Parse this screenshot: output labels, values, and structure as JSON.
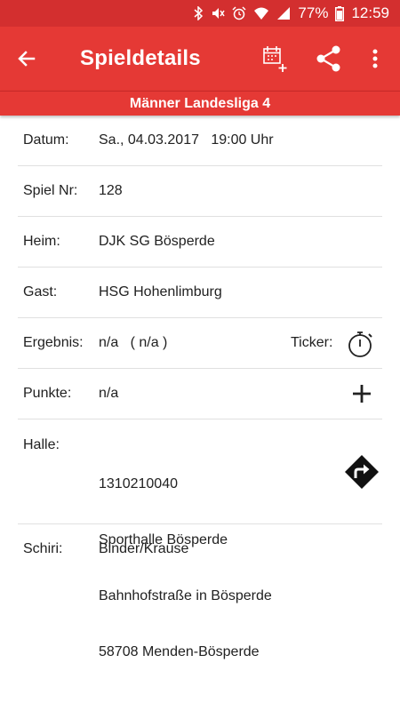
{
  "status_bar": {
    "battery_percent": "77%",
    "time": "12:59",
    "icons": [
      "bluetooth-icon",
      "mute-icon",
      "alarm-icon",
      "wifi-icon",
      "signal-icon",
      "battery-icon"
    ]
  },
  "app_bar": {
    "title": "Spieldetails",
    "actions": [
      "back-arrow-icon",
      "calendar-add-icon",
      "share-icon",
      "more-vert-icon"
    ]
  },
  "league": "Männer Landesliga 4",
  "details": {
    "datum": {
      "label": "Datum:",
      "value": "Sa., 04.03.2017   19:00 Uhr"
    },
    "spiel_nr": {
      "label": "Spiel Nr:",
      "value": "128"
    },
    "heim": {
      "label": "Heim:",
      "value": "DJK SG Bösperde"
    },
    "gast": {
      "label": "Gast:",
      "value": "HSG Hohenlimburg"
    },
    "ergebnis": {
      "label": "Ergebnis:",
      "value": "n/a   ( n/a )",
      "ticker_label": "Ticker:",
      "ticker_icon": "stopwatch-icon"
    },
    "punkte": {
      "label": "Punkte:",
      "value": "n/a",
      "action_icon": "plus-icon"
    },
    "halle": {
      "label": "Halle:",
      "lines": [
        "1310210040",
        "Sporthalle Bösperde",
        "Bahnhofstraße in Bösperde",
        "58708 Menden-Bösperde"
      ],
      "action_icon": "directions-icon"
    },
    "schiri": {
      "label": "Schiri:",
      "value": "Binder/Krause"
    }
  },
  "colors": {
    "primary": "#e53935",
    "status_bar": "#d32f2f",
    "divider": "#e0e0e0",
    "text": "#212121"
  }
}
